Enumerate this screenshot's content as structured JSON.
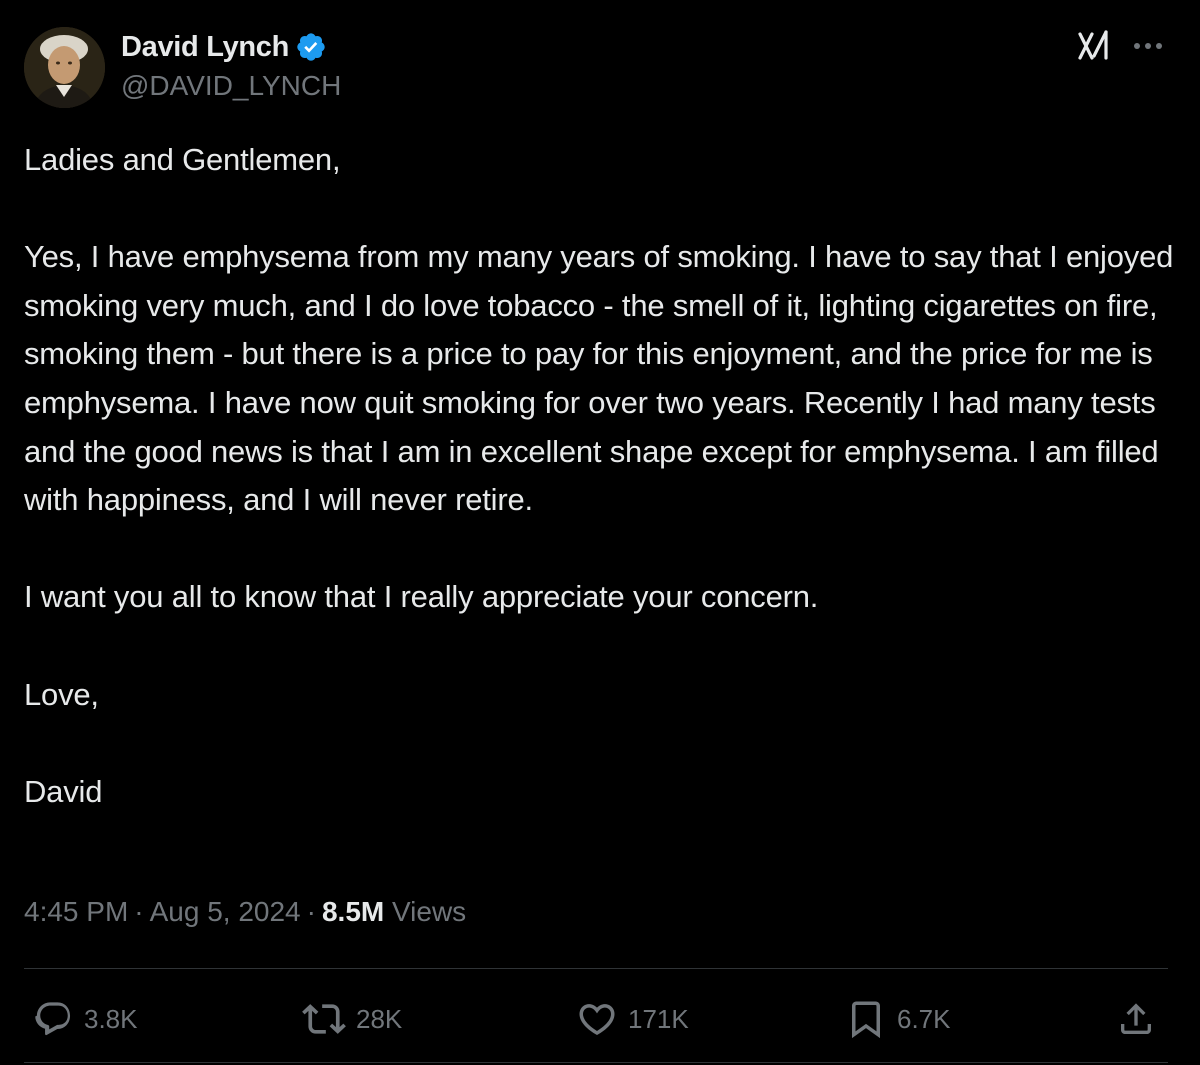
{
  "author": {
    "display_name": "David Lynch",
    "handle": "@DAVID_LYNCH",
    "verified": true,
    "verified_color": "#1d9bf0"
  },
  "tweet": {
    "paragraphs": [
      "Ladies and Gentlemen,",
      "Yes, I have emphysema from my many years of smoking. I have to say that I enjoyed smoking very much, and I do love tobacco - the smell of it, lighting cigarettes on fire, smoking them - but there is a price to pay for this enjoyment, and the price for me is emphysema. I have now quit smoking for over two years. Recently I had many tests and the good news is that I am in excellent shape except for emphysema. I am filled with happiness, and I will never retire.",
      "I want you all to know that I really appreciate your concern.",
      "Love,",
      "David"
    ],
    "time": "4:45 PM",
    "date": "Aug 5, 2024",
    "views_count": "8.5M",
    "views_label": "Views",
    "separator": "·"
  },
  "actions": {
    "replies": "3.8K",
    "reposts": "28K",
    "likes": "171K",
    "bookmarks": "6.7K"
  },
  "icons": {
    "grok": "grok-icon",
    "more": "more-icon",
    "reply": "reply-icon",
    "repost": "repost-icon",
    "like": "heart-icon",
    "bookmark": "bookmark-icon",
    "share": "share-icon"
  },
  "colors": {
    "background": "#000000",
    "text_primary": "#e7e9ea",
    "text_secondary": "#71767b",
    "divider": "#2f3336"
  }
}
